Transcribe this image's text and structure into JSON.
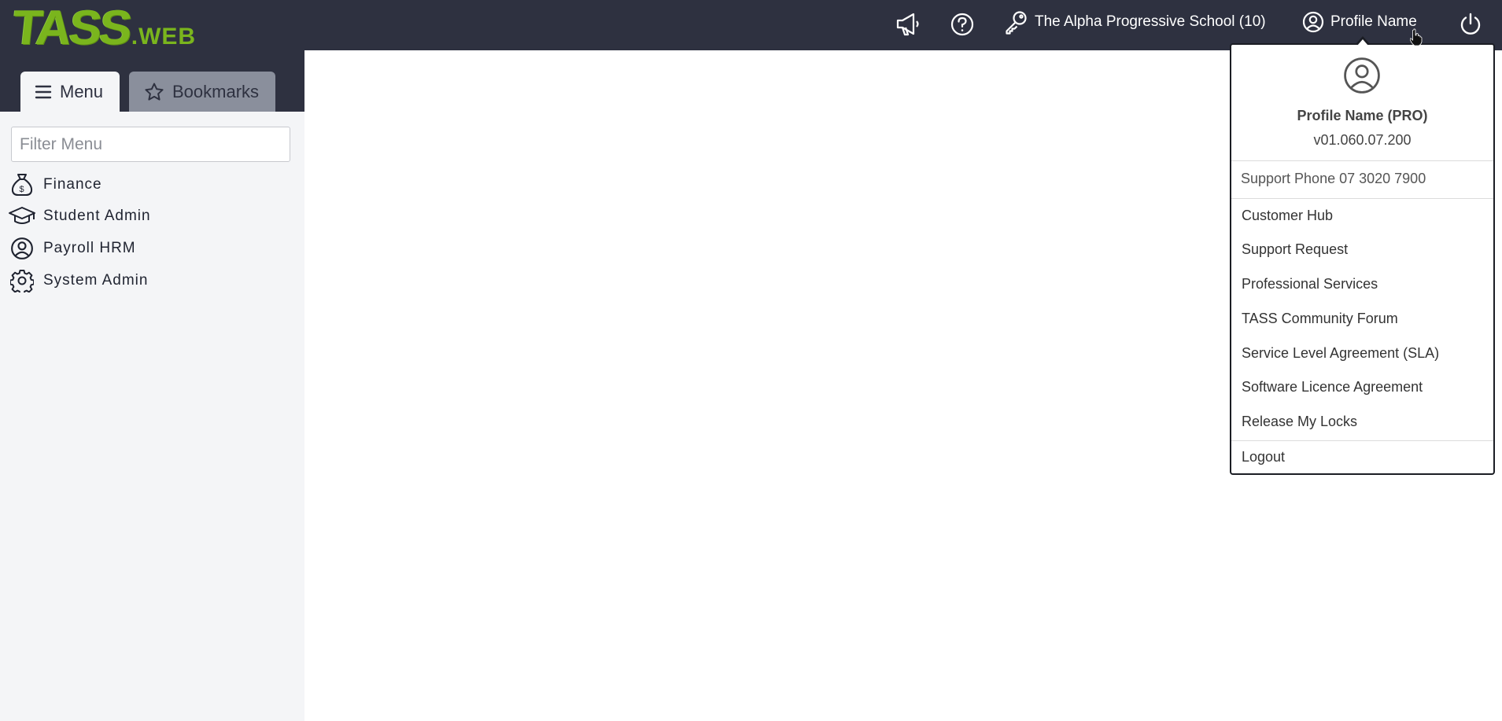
{
  "topbar": {
    "logo_main": "TASS",
    "logo_suffix": ".WEB",
    "announcements_icon": "megaphone-icon",
    "help_icon": "question-circle-icon",
    "school_icon": "key-icon",
    "school": "The Alpha Progressive School (10)",
    "profile_icon": "user-circle-icon",
    "profile": "Profile Name",
    "power_icon": "power-icon"
  },
  "sidebar": {
    "tabs": [
      {
        "label": "Menu",
        "icon": "hamburger-icon"
      },
      {
        "label": "Bookmarks",
        "icon": "star-icon"
      }
    ],
    "filter_placeholder": "Filter Menu",
    "items": [
      {
        "label": "Finance",
        "icon": "money-bag-icon"
      },
      {
        "label": "Student Admin",
        "icon": "graduation-cap-icon"
      },
      {
        "label": "Payroll HRM",
        "icon": "user-circle-icon"
      },
      {
        "label": "System Admin",
        "icon": "gear-icon"
      }
    ]
  },
  "profile_dropdown": {
    "name": "Profile Name (PRO)",
    "version": "v01.060.07.200",
    "support_phone": "Support Phone 07 3020 7900",
    "links": [
      "Customer Hub",
      "Support Request",
      "Professional Services",
      "TASS Community Forum",
      "Service Level Agreement (SLA)",
      "Software Licence Agreement",
      "Release My Locks"
    ],
    "logout": "Logout"
  },
  "colors": {
    "topbar": "#2e3140",
    "sidebar_bg": "#f4f5f7",
    "logo_green": "#7ab51d",
    "inactive_tab": "#8a8f9c"
  }
}
